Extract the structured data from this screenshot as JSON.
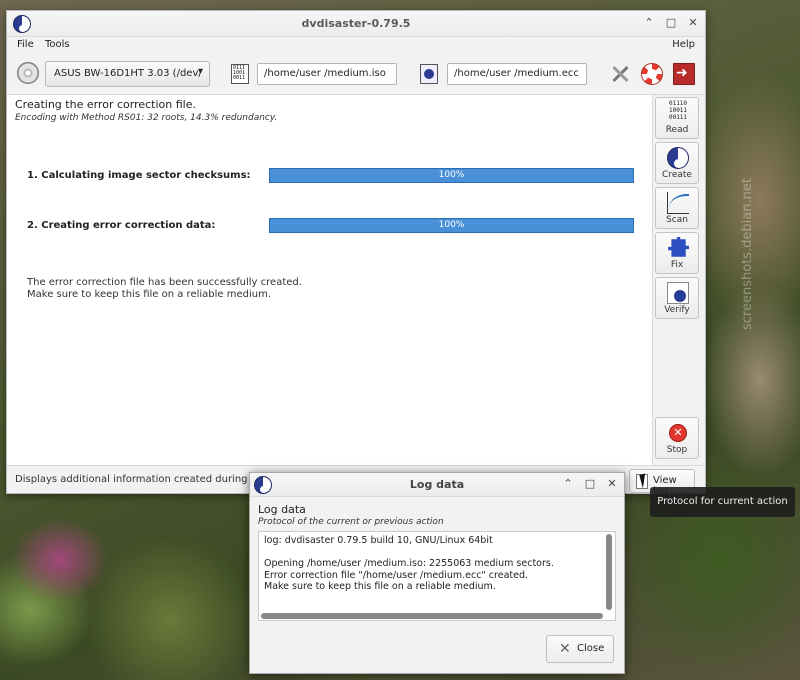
{
  "window": {
    "title": "dvdisaster-0.79.5"
  },
  "window_controls": {
    "minimize": "⌃",
    "maximize": "□",
    "close": "✕"
  },
  "menu": {
    "file": "File",
    "tools": "Tools",
    "help": "Help"
  },
  "toolbar": {
    "drive": "ASUS BW-16D1HT 3.03 (/dev/",
    "drive_arrow": "▾",
    "image_file_icon_text": "0111\n1001\n0011",
    "image_path": "/home/user /medium.iso",
    "ecc_path": "/home/user /medium.ecc"
  },
  "content": {
    "heading": "Creating the error correction file.",
    "subheading": "Encoding with Method RS01: 32 roots, 14.3% redundancy.",
    "steps": [
      {
        "label": "1. Calculating image sector checksums:",
        "progress_text": "100%",
        "progress": 1.0
      },
      {
        "label": "2. Creating error correction data:",
        "progress_text": "100%",
        "progress": 1.0
      }
    ],
    "message_line1": "The error correction file has been successfully created.",
    "message_line2": "Make sure to keep this file on a reliable medium."
  },
  "side_panel": {
    "read_icon_text": "01110\n10011\n00111",
    "read": "Read",
    "create": "Create",
    "scan": "Scan",
    "fix": "Fix",
    "verify": "Verify",
    "stop": "Stop",
    "stop_icon_glyph": "✕"
  },
  "statusbar": {
    "text": "Displays additional information created during the",
    "view_log": "View log"
  },
  "tooltip": {
    "text": "Protocol for current action"
  },
  "log_dialog": {
    "title": "Log data",
    "heading": "Log data",
    "subheading": "Protocol of the current or previous action",
    "text": "log: dvdisaster 0.79.5 build 10, GNU/Linux 64bit\n\nOpening /home/user /medium.iso: 2255063 medium sectors.\nError correction file \"/home/user /medium.ecc\" created.\nMake sure to keep this file on a reliable medium.",
    "close": "Close",
    "close_glyph": "✕"
  },
  "watermark": {
    "text": "screenshots.debian.net"
  }
}
